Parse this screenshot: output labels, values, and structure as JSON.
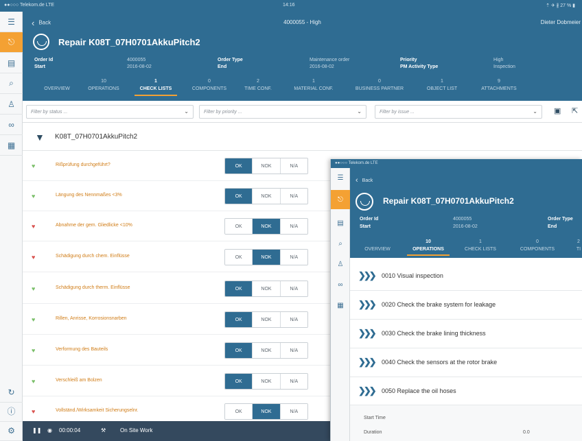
{
  "status": {
    "carrier": "●●○○○ Telekom.de  LTE",
    "time": "14:16",
    "battery": "⇡ ✈ ∦ 27 % ▮"
  },
  "header": {
    "back_label": "Back",
    "title": "4000055 - High",
    "user": "Dieter Dobmeier",
    "object_title": "Repair K08T_07H0701AkkuPitch2",
    "fields": {
      "order_id_label": "Order Id",
      "order_id_value": "4000055",
      "start_label": "Start",
      "start_value": "2016-08-02",
      "order_type_label": "Order Type",
      "order_type_value": "Maintenance order",
      "end_label": "End",
      "end_value": "2016-08-02",
      "priority_label": "Priority",
      "priority_value": "High",
      "pm_activity_label": "PM Activity Type",
      "pm_activity_value": "Inspection"
    },
    "tabs": [
      {
        "count": "",
        "label": "OVERVIEW"
      },
      {
        "count": "10",
        "label": "OPERATIONS"
      },
      {
        "count": "1",
        "label": "CHECK LISTS"
      },
      {
        "count": "0",
        "label": "COMPONENTS"
      },
      {
        "count": "2",
        "label": "TIME CONF."
      },
      {
        "count": "1",
        "label": "MATERIAL CONF."
      },
      {
        "count": "0",
        "label": "BUSINESS PARTNER"
      },
      {
        "count": "1",
        "label": "OBJECT LIST"
      },
      {
        "count": "9",
        "label": "ATTACHMENTS"
      }
    ]
  },
  "filters": {
    "status_placeholder": "Filter by status ...",
    "priority_placeholder": "Filter by priority ...",
    "issue_placeholder": "Filter by issue ..."
  },
  "checklist": {
    "title": "K08T_07H0701AkkuPitch2",
    "options": [
      "OK",
      "NOK",
      "N/A"
    ],
    "items": [
      {
        "label": "Rißprüfung durchgeführt?",
        "status": "ok",
        "selected": 0
      },
      {
        "label": "Längung des Nennmaßes <3%",
        "status": "ok",
        "selected": 0
      },
      {
        "label": "Abnahme der gem. Gliedlicke <10%",
        "status": "nok",
        "selected": 1
      },
      {
        "label": "Schädigung durch chem. Einflüsse",
        "status": "nok",
        "selected": 1
      },
      {
        "label": "Schädigung durch therm. Einflüsse",
        "status": "ok",
        "selected": 0
      },
      {
        "label": "Rillen, Anrisse, Korrosionsnarben",
        "status": "ok",
        "selected": 0
      },
      {
        "label": "Verformung des Bauteils",
        "status": "ok",
        "selected": 0
      },
      {
        "label": "Verschleiß am Bolzen",
        "status": "ok",
        "selected": 0
      },
      {
        "label": "Vollständ./Wirksamkeit Sicherungselnr.",
        "status": "nok",
        "selected": 1
      }
    ]
  },
  "bottombar": {
    "timer": "00:00:04",
    "status": "On Site Work"
  },
  "overlay": {
    "status": "●●○○○ Telekom.de  LTE",
    "back_label": "Back",
    "object_title": "Repair K08T_07H0701AkkuPitch2",
    "order_id_label": "Order Id",
    "order_id_value": "4000055",
    "start_label": "Start",
    "start_value": "2016-08-02",
    "order_type_label": "Order Type",
    "end_label": "End",
    "tabs": [
      {
        "count": "",
        "label": "OVERVIEW"
      },
      {
        "count": "10",
        "label": "OPERATIONS"
      },
      {
        "count": "1",
        "label": "CHECK LISTS"
      },
      {
        "count": "0",
        "label": "COMPONENTS"
      },
      {
        "count": "2",
        "label": "TI"
      }
    ],
    "operations": [
      "0010 Visual inspection",
      "0020 Check the brake system for leakage",
      "0030 Check the brake lining thickness",
      "0040 Check the sensors at the rotor brake",
      "0050 Replace the oil hoses"
    ],
    "start_time_label": "Start Time",
    "duration_label": "Duration",
    "duration_value": "0.0"
  }
}
